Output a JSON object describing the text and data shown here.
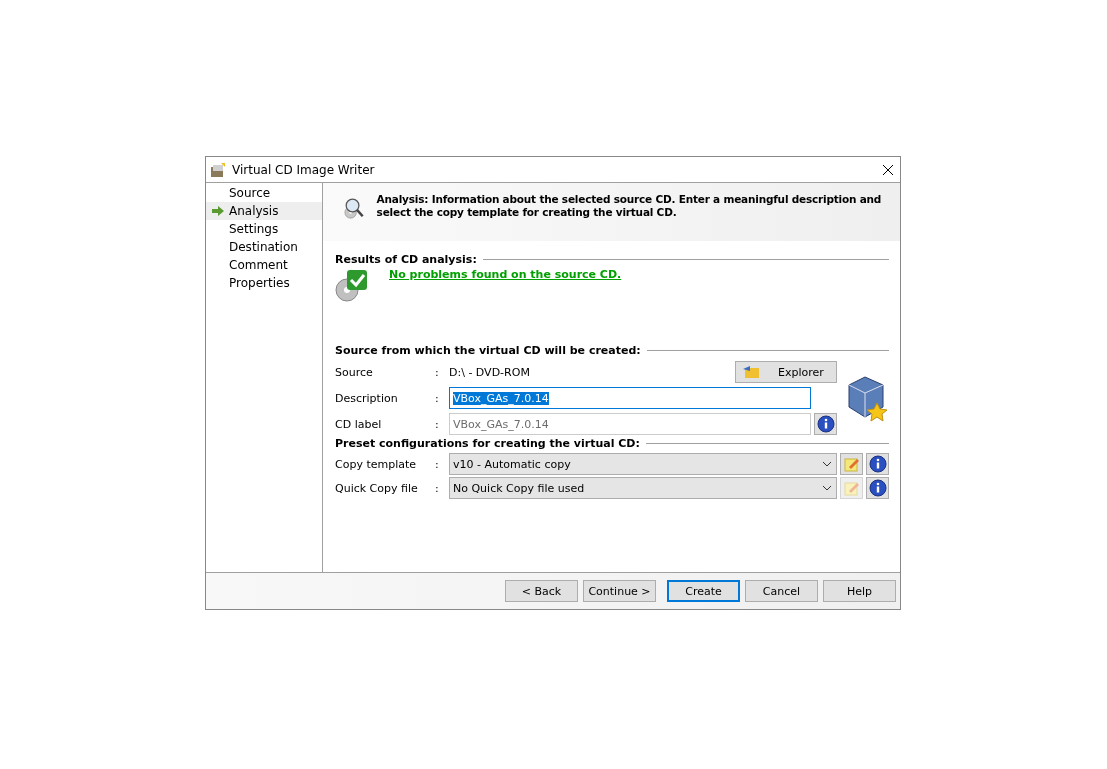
{
  "window": {
    "title": "Virtual CD Image Writer"
  },
  "sidebar": {
    "items": [
      {
        "label": "Source",
        "selected": false
      },
      {
        "label": "Analysis",
        "selected": true
      },
      {
        "label": "Settings",
        "selected": false
      },
      {
        "label": "Destination",
        "selected": false
      },
      {
        "label": "Comment",
        "selected": false
      },
      {
        "label": "Properties",
        "selected": false
      }
    ]
  },
  "header": {
    "text": "Analysis: Information about the selected source CD. Enter a meaningful description and select the copy template for creating the virtual CD."
  },
  "results": {
    "heading": "Results of CD analysis:",
    "message": "No problems found on the source CD."
  },
  "source_section": {
    "heading": "Source from which the virtual CD will be created:",
    "explorer_button": "Explorer",
    "fields": [
      {
        "kind": "text",
        "label": "Source",
        "colon": ":",
        "value": "D:\\ - DVD-ROM"
      },
      {
        "kind": "input",
        "label": "Description",
        "colon": ":",
        "value": "VBox_GAs_7.0.14",
        "text_selected": true,
        "disabled": false
      },
      {
        "kind": "input",
        "label": "CD label",
        "colon": ":",
        "value": "VBox_GAs_7.0.14",
        "text_selected": false,
        "disabled": true,
        "info": true
      }
    ]
  },
  "preset_section": {
    "heading": "Preset configurations for creating the virtual CD:",
    "fields": [
      {
        "label": "Copy template",
        "colon": ":",
        "value": "v10 - Automatic copy",
        "edit_disabled": false
      },
      {
        "label": "Quick Copy file",
        "colon": ":",
        "value": "No Quick Copy file used",
        "edit_disabled": true
      }
    ]
  },
  "buttons": [
    {
      "label": "< Back",
      "default": false
    },
    {
      "label": "Continue >",
      "default": false
    },
    {
      "label": "Create",
      "default": true
    },
    {
      "label": "Cancel",
      "default": false
    },
    {
      "label": "Help",
      "default": false
    }
  ]
}
